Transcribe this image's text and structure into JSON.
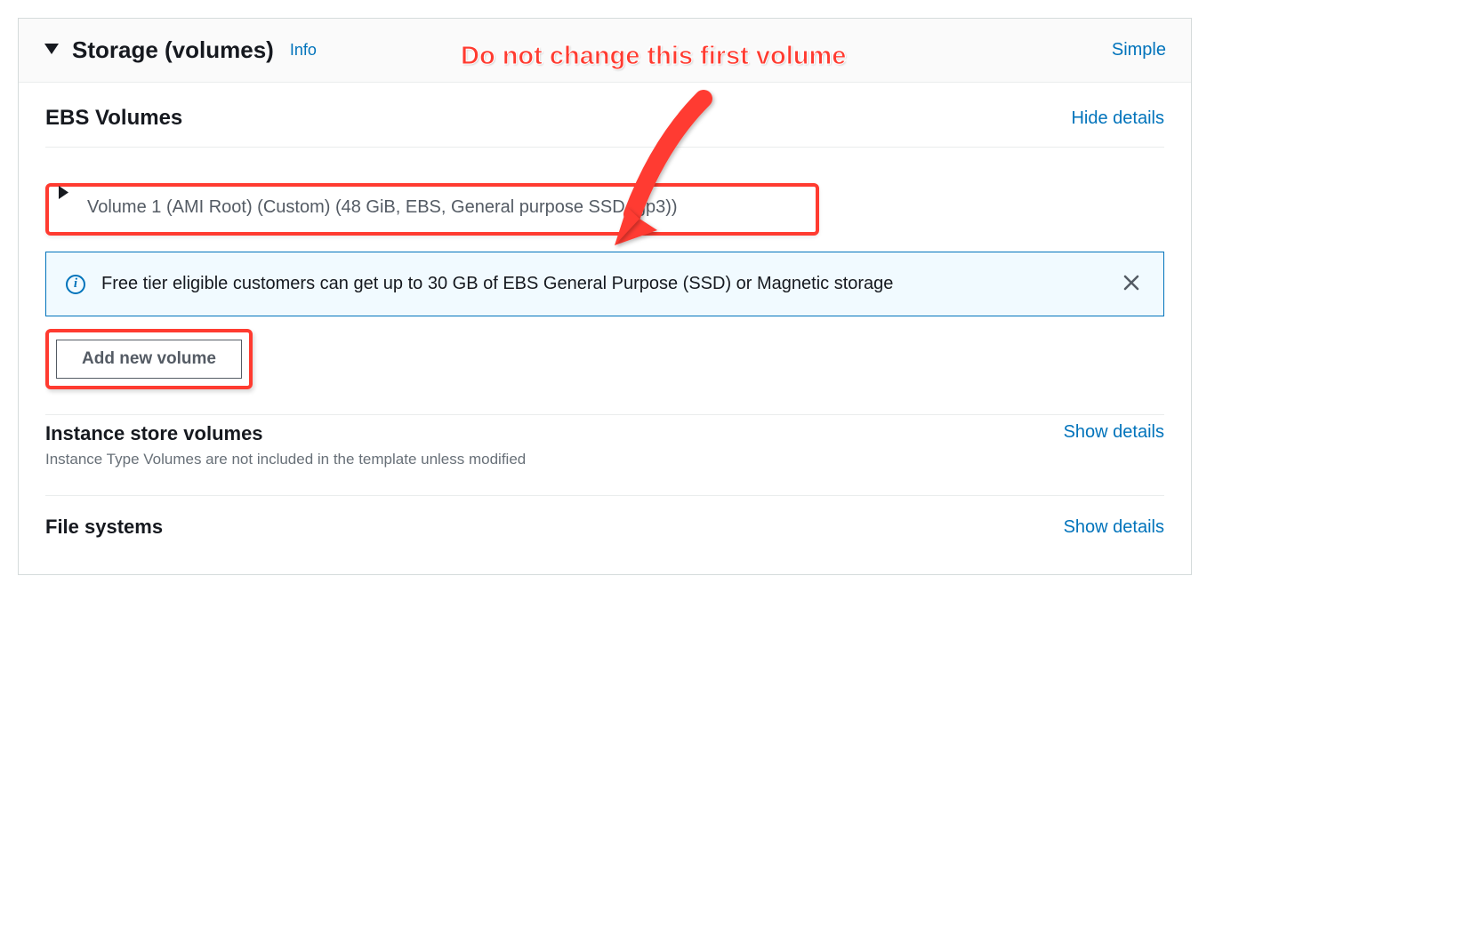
{
  "header": {
    "title": "Storage (volumes)",
    "info_label": "Info",
    "simple_label": "Simple"
  },
  "ebs": {
    "title": "EBS Volumes",
    "hide_label": "Hide details",
    "volume1_label": "Volume 1 (AMI Root) (Custom) (48 GiB, EBS, General purpose SSD (gp3))"
  },
  "alert": {
    "text": "Free tier eligible customers can get up to 30 GB of EBS General Purpose (SSD) or Magnetic storage"
  },
  "add_volume_label": "Add new volume",
  "instance_store": {
    "title": "Instance store volumes",
    "subtitle": "Instance Type Volumes are not included in the template unless modified",
    "show_label": "Show details"
  },
  "file_systems": {
    "title": "File systems",
    "show_label": "Show details"
  },
  "annotation": {
    "text": "Do not change this first volume"
  }
}
